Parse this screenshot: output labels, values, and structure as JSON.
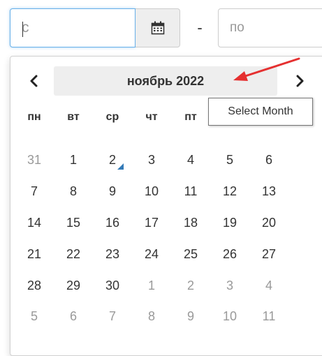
{
  "date_from": {
    "value": "с",
    "placeholder": ""
  },
  "calendar_button": {
    "icon": "calendar-icon"
  },
  "range_separator": "-",
  "date_to": {
    "value": "",
    "placeholder": "по"
  },
  "datepicker": {
    "prev_icon": "chevron-left-icon",
    "next_icon": "chevron-right-icon",
    "month_title": "ноябрь 2022",
    "tooltip": "Select Month",
    "weekdays": [
      "пн",
      "вт",
      "ср",
      "чт",
      "пт",
      "сб",
      "вс"
    ],
    "weeks": [
      [
        "31",
        "1",
        "2",
        "3",
        "4",
        "5",
        "6"
      ],
      [
        "7",
        "8",
        "9",
        "10",
        "11",
        "12",
        "13"
      ],
      [
        "14",
        "15",
        "16",
        "17",
        "18",
        "19",
        "20"
      ],
      [
        "21",
        "22",
        "23",
        "24",
        "25",
        "26",
        "27"
      ],
      [
        "28",
        "29",
        "30",
        "1",
        "2",
        "3",
        "4"
      ],
      [
        "5",
        "6",
        "7",
        "8",
        "9",
        "10",
        "11"
      ]
    ],
    "accent_color": "#337ab7"
  },
  "annotation": {
    "arrow_color": "#e53030"
  }
}
